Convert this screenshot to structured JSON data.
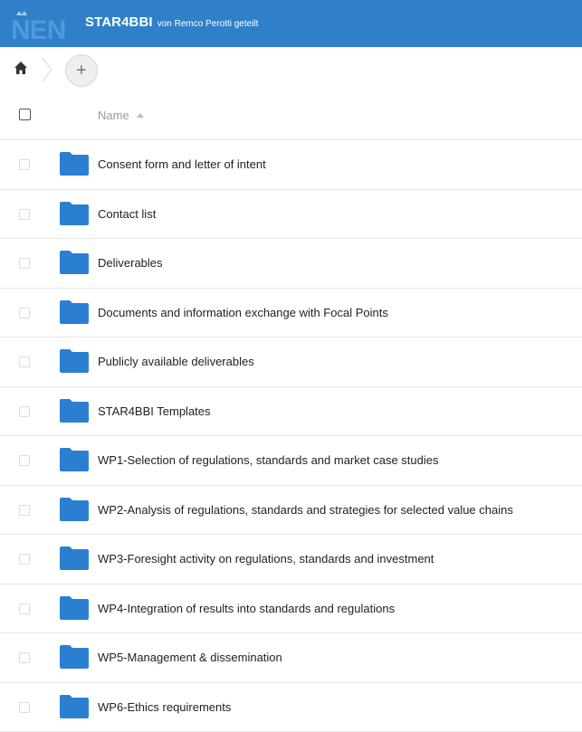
{
  "header": {
    "logo_text": "NEN",
    "app_name": "STAR4BBI",
    "shared_by": "von Remco Perotti geteilt",
    "background_color": "#2f80c9"
  },
  "toolbar": {
    "home_icon": "home-icon",
    "add_label": "+"
  },
  "list_header": {
    "name_label": "Name",
    "sort_icon": "sort-ascending-icon"
  },
  "folder_color": "#2b7fd0",
  "folders": [
    {
      "name": "Consent form and letter of intent"
    },
    {
      "name": "Contact list"
    },
    {
      "name": "Deliverables"
    },
    {
      "name": "Documents and information exchange with Focal Points"
    },
    {
      "name": "Publicly available deliverables"
    },
    {
      "name": "STAR4BBI Templates"
    },
    {
      "name": "WP1-Selection of regulations, standards and market case studies"
    },
    {
      "name": "WP2-Analysis of regulations, standards and strategies for selected value chains"
    },
    {
      "name": "WP3-Foresight activity on regulations, standards and investment"
    },
    {
      "name": "WP4-Integration of results into standards and regulations"
    },
    {
      "name": "WP5-Management & dissemination"
    },
    {
      "name": "WP6-Ethics requirements"
    }
  ]
}
